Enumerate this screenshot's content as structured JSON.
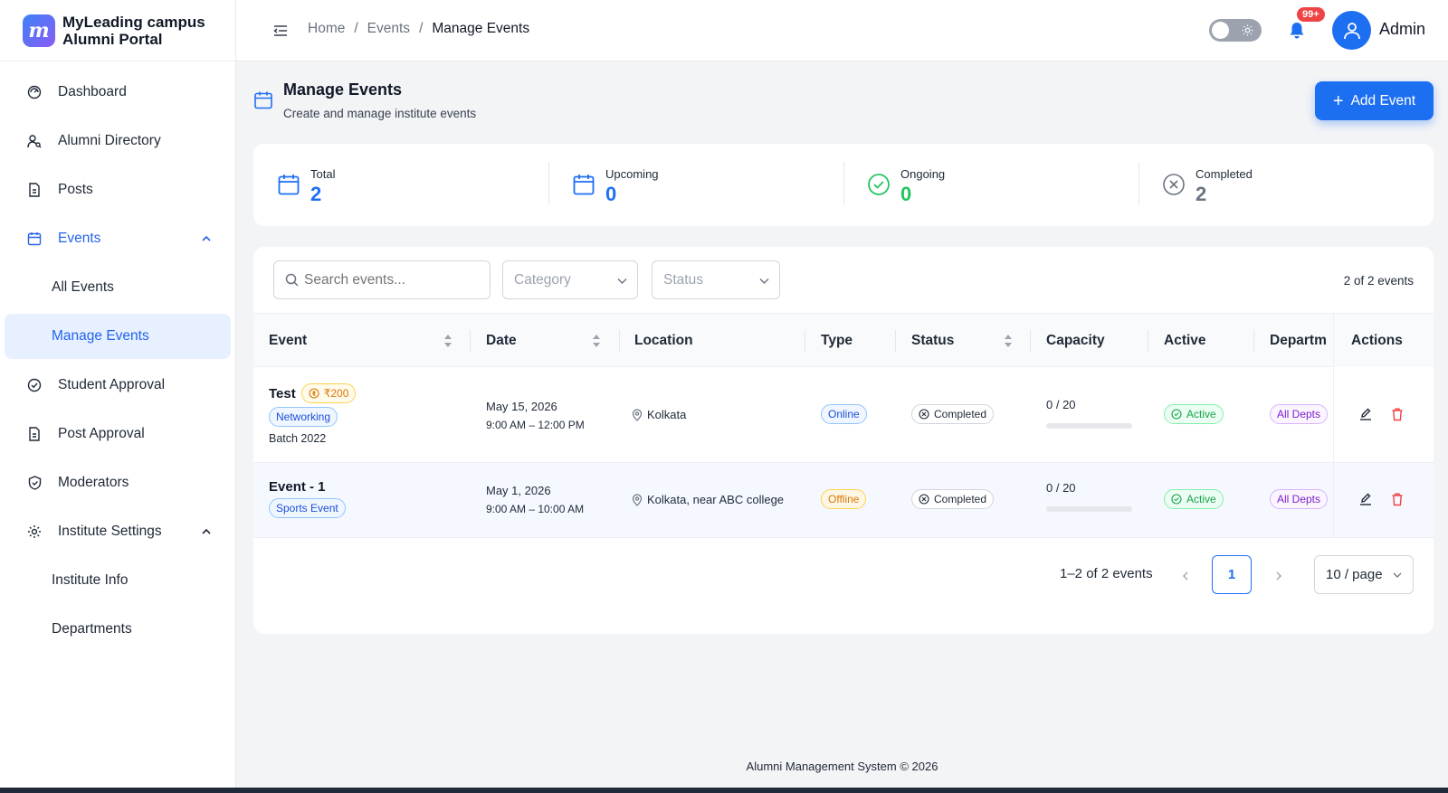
{
  "brand": {
    "line1": "MyLeading campus",
    "line2": "Alumni Portal",
    "logo_letter": "m"
  },
  "sidebar": {
    "items": [
      {
        "label": "Dashboard",
        "icon": "gauge-icon"
      },
      {
        "label": "Alumni Directory",
        "icon": "users-search-icon"
      },
      {
        "label": "Posts",
        "icon": "file-icon"
      },
      {
        "label": "Events",
        "icon": "calendar-icon",
        "expanded": true
      },
      {
        "label": "All Events"
      },
      {
        "label": "Manage Events",
        "active": true
      },
      {
        "label": "Student Approval",
        "icon": "check-circle-icon"
      },
      {
        "label": "Post Approval",
        "icon": "file-icon"
      },
      {
        "label": "Moderators",
        "icon": "shield-check-icon"
      },
      {
        "label": "Institute Settings",
        "icon": "gear-icon",
        "expanded": true
      },
      {
        "label": "Institute Info"
      },
      {
        "label": "Departments"
      }
    ]
  },
  "topbar": {
    "breadcrumb": [
      "Home",
      "Events",
      "Manage Events"
    ],
    "separator": "/",
    "notification_count": "99+",
    "user_name": "Admin"
  },
  "page": {
    "title": "Manage Events",
    "subtitle": "Create and manage institute events",
    "add_button": "Add Event"
  },
  "stats": [
    {
      "label": "Total",
      "value": "2",
      "color": "#1d6ff2"
    },
    {
      "label": "Upcoming",
      "value": "0",
      "color": "#1d6ff2"
    },
    {
      "label": "Ongoing",
      "value": "0",
      "color": "#22c55e"
    },
    {
      "label": "Completed",
      "value": "2",
      "color": "#6b7280"
    }
  ],
  "filters": {
    "search_placeholder": "Search events...",
    "category_placeholder": "Category",
    "status_placeholder": "Status",
    "count_text": "2 of 2 events"
  },
  "table": {
    "columns": [
      "Event",
      "Date",
      "Location",
      "Type",
      "Status",
      "Capacity",
      "Active",
      "Departm",
      "Actions"
    ],
    "rows": [
      {
        "name": "Test",
        "price": "₹200",
        "category": "Networking",
        "batch": "Batch 2022",
        "date": "May 15, 2026",
        "time": "9:00 AM – 12:00 PM",
        "location": "Kolkata",
        "type": "Online",
        "status": "Completed",
        "capacity": "0 / 20",
        "capacity_fill": 0,
        "active": "Active",
        "department": "All Depts"
      },
      {
        "name": "Event - 1",
        "category": "Sports Event",
        "date": "May 1, 2026",
        "time": "9:00 AM – 10:00 AM",
        "location": "Kolkata, near ABC college",
        "type": "Offline",
        "status": "Completed",
        "capacity": "0 / 20",
        "capacity_fill": 0,
        "active": "Active",
        "department": "All Depts"
      }
    ]
  },
  "pagination": {
    "range_text": "1–2 of 2 events",
    "current_page": "1",
    "page_size": "10 / page"
  },
  "footer": {
    "text": "Alumni Management System © 2026"
  }
}
